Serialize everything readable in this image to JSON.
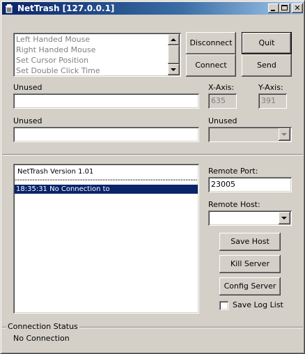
{
  "window": {
    "title": "NetTrash [127.0.0.1]"
  },
  "commands": {
    "items": [
      "Left Handed Mouse",
      "Right Handed Mouse",
      "Set Cursor Position",
      "Set Double Click Time"
    ]
  },
  "buttons": {
    "disconnect": "Disconnect",
    "quit": "Quit",
    "connect": "Connect",
    "send": "Send",
    "save_host": "Save Host",
    "kill_server": "Kill Server",
    "config_server": "Config Server"
  },
  "fields": {
    "unused1_label": "Unused",
    "unused1_value": "",
    "x_axis_label": "X-Axis:",
    "x_axis_value": "635",
    "y_axis_label": "Y-Axis:",
    "y_axis_value": "391",
    "unused2_label": "Unused",
    "unused2_value": "",
    "unused3_label": "Unused",
    "unused3_value": ""
  },
  "log": {
    "header": "NetTrash   Version 1.01",
    "divider": "-----------------------------------------------------------------------------------------",
    "entries": [
      "18:35:31  No Connection to"
    ]
  },
  "remote": {
    "port_label": "Remote Port:",
    "port_value": "23005",
    "host_label": "Remote Host:",
    "host_value": ""
  },
  "save_log": {
    "label": "Save Log List",
    "checked": false
  },
  "status": {
    "group_label": "Connection Status",
    "text": "No Connection"
  }
}
